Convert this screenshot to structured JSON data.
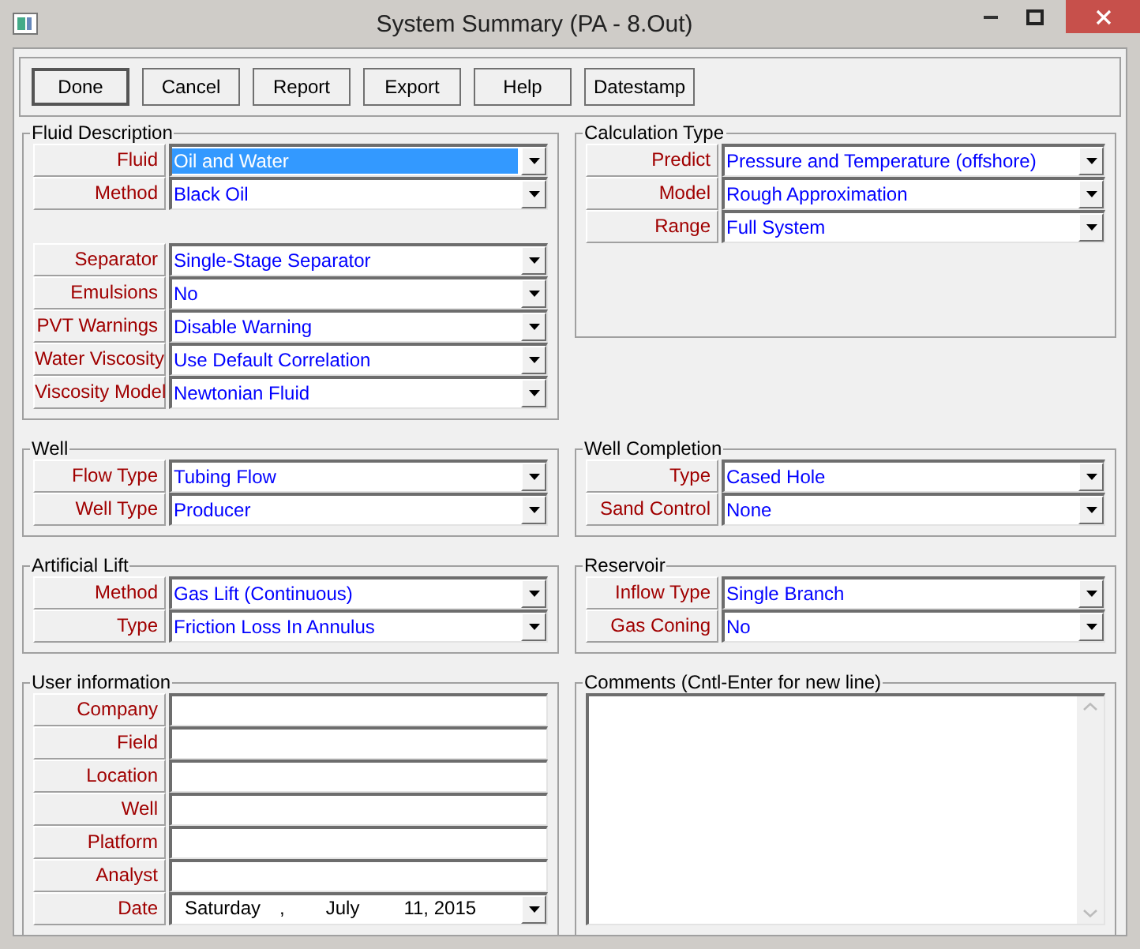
{
  "window": {
    "title": "System Summary (PA - 8.Out)"
  },
  "buttons": [
    {
      "label": "Done",
      "default": true
    },
    {
      "label": "Cancel",
      "default": false
    },
    {
      "label": "Report",
      "default": false
    },
    {
      "label": "Export",
      "default": false
    },
    {
      "label": "Help",
      "default": false
    },
    {
      "label": "Datestamp",
      "default": false
    }
  ],
  "groups": [
    {
      "title": "Fluid Description",
      "kind": "fields",
      "blocks": [
        [
          {
            "kind": "combo",
            "label": "Fluid",
            "value": "Oil and Water",
            "selected": true
          },
          {
            "kind": "combo",
            "label": "Method",
            "value": "Black Oil",
            "selected": false
          }
        ],
        [
          {
            "kind": "combo",
            "label": "Separator",
            "value": "Single-Stage Separator",
            "selected": false
          },
          {
            "kind": "combo",
            "label": "Emulsions",
            "value": "No",
            "selected": false
          },
          {
            "kind": "combo",
            "label": "PVT Warnings",
            "value": "Disable Warning",
            "selected": false
          },
          {
            "kind": "combo",
            "label": "Water Viscosity",
            "value": "Use Default Correlation",
            "selected": false
          },
          {
            "kind": "combo",
            "label": "Viscosity Model",
            "value": "Newtonian Fluid",
            "selected": false
          }
        ]
      ]
    },
    {
      "title": "Calculation Type",
      "kind": "fields",
      "blocks": [
        [
          {
            "kind": "combo",
            "label": "Predict",
            "value": "Pressure and Temperature (offshore)",
            "selected": false
          },
          {
            "kind": "combo",
            "label": "Model",
            "value": "Rough Approximation",
            "selected": false
          },
          {
            "kind": "combo",
            "label": "Range",
            "value": "Full System",
            "selected": false
          }
        ]
      ]
    },
    {
      "title": "Well",
      "kind": "fields",
      "blocks": [
        [
          {
            "kind": "combo",
            "label": "Flow Type",
            "value": "Tubing Flow",
            "selected": false
          },
          {
            "kind": "combo",
            "label": "Well Type",
            "value": "Producer",
            "selected": false
          }
        ]
      ]
    },
    {
      "title": "Well Completion",
      "kind": "fields",
      "blocks": [
        [
          {
            "kind": "combo",
            "label": "Type",
            "value": "Cased Hole",
            "selected": false
          },
          {
            "kind": "combo",
            "label": "Sand Control",
            "value": "None",
            "selected": false
          }
        ]
      ]
    },
    {
      "title": "Artificial Lift",
      "kind": "fields",
      "blocks": [
        [
          {
            "kind": "combo",
            "label": "Method",
            "value": "Gas Lift (Continuous)",
            "selected": false
          },
          {
            "kind": "combo",
            "label": "Type",
            "value": "Friction Loss In Annulus",
            "selected": false
          }
        ]
      ]
    },
    {
      "title": "Reservoir",
      "kind": "fields",
      "blocks": [
        [
          {
            "kind": "combo",
            "label": "Inflow Type",
            "value": "Single Branch",
            "selected": false
          },
          {
            "kind": "combo",
            "label": "Gas Coning",
            "value": "No",
            "selected": false
          }
        ]
      ]
    },
    {
      "title": "User information",
      "kind": "fields",
      "blocks": [
        [
          {
            "kind": "text",
            "label": "Company"
          },
          {
            "kind": "text",
            "label": "Field"
          },
          {
            "kind": "text",
            "label": "Location"
          },
          {
            "kind": "text",
            "label": "Well"
          },
          {
            "kind": "text",
            "label": "Platform"
          },
          {
            "kind": "text",
            "label": "Analyst"
          },
          {
            "kind": "date",
            "label": "Date",
            "date": {
              "weekday": "Saturday",
              "separator": ",",
              "month": "July",
              "day_year": "11, 2015"
            }
          }
        ]
      ]
    },
    {
      "title": "Comments (Cntl-Enter for new line)",
      "kind": "memo"
    }
  ]
}
